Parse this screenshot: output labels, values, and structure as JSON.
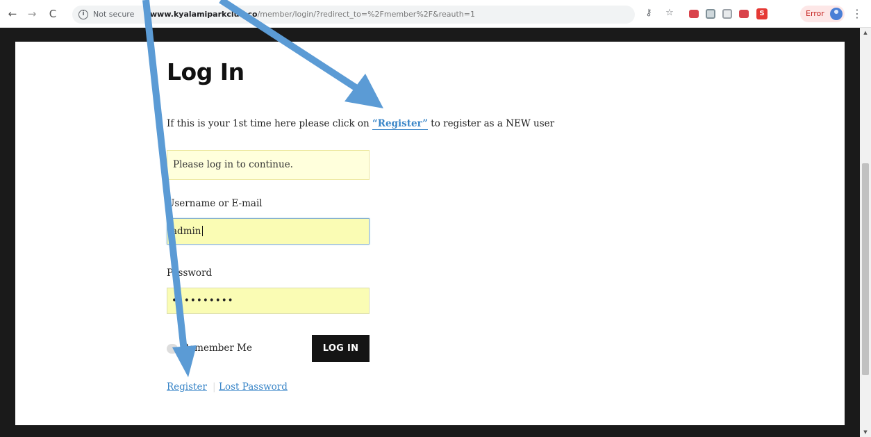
{
  "browser": {
    "security_label": "Not secure",
    "url_host": "www.kyalamiparkclub.co",
    "url_path": "/member/login/?redirect_to=%2Fmember%2F&reauth=1",
    "error_label": "Error"
  },
  "page": {
    "title": "Log In",
    "intro_before": "If this is your 1st time here please click on ",
    "intro_link": "“Register”",
    "intro_after": " to register as a NEW user",
    "notice": "Please log in to continue.",
    "username_label": "Username or E-mail",
    "username_value": "admin",
    "password_label": "Password",
    "password_value": "••••••••••",
    "remember_label": "Remember Me",
    "login_button": "LOG IN",
    "register_link": "Register",
    "separator": "|",
    "lost_password_link": "Lost Password"
  },
  "icons": {
    "back": "arrow-left",
    "forward": "arrow-right",
    "reload": "reload",
    "info": "info",
    "key": "key",
    "star": "star",
    "menu": "kebab"
  },
  "colors": {
    "link": "#3a86c8",
    "notice_bg": "#ffffdc",
    "autofill_bg": "#fafcb4",
    "button_bg": "#141414",
    "frame": "#1a1a1a",
    "annotation": "#5b9bd5"
  }
}
